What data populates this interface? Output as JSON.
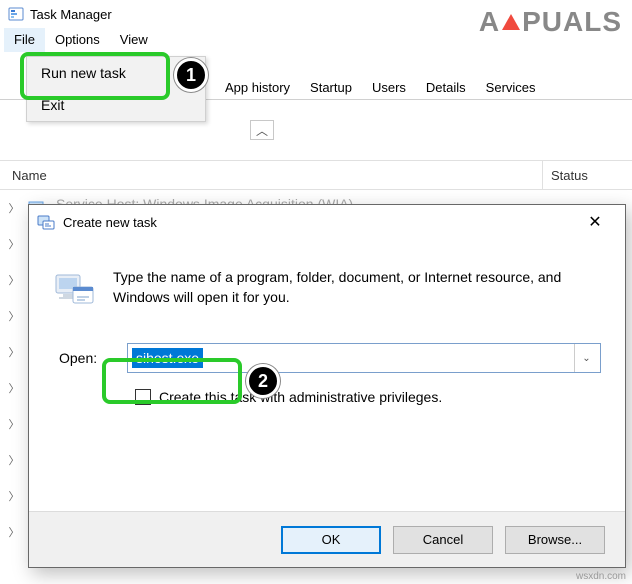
{
  "window": {
    "title": "Task Manager"
  },
  "menu": {
    "file": "File",
    "options": "Options",
    "view": "View"
  },
  "file_menu": {
    "run_new_task": "Run new task",
    "exit": "Exit"
  },
  "tabs": {
    "app_history": "App history",
    "startup": "Startup",
    "users": "Users",
    "details": "Details",
    "services": "Services"
  },
  "columns": {
    "name": "Name",
    "status": "Status"
  },
  "first_row_faded": "Service Host: Windows Image Acquisition (WIA)",
  "dialog": {
    "title": "Create new task",
    "description": "Type the name of a program, folder, document, or Internet resource, and Windows will open it for you.",
    "open_label": "Open:",
    "input_value": "sihost.exe",
    "admin_label": "Create this task with administrative privileges.",
    "ok": "OK",
    "cancel": "Cancel",
    "browse": "Browse..."
  },
  "badges": {
    "one": "1",
    "two": "2"
  },
  "watermark": {
    "pre": "A",
    "post": "PUALS"
  },
  "credit": "wsxdn.com"
}
